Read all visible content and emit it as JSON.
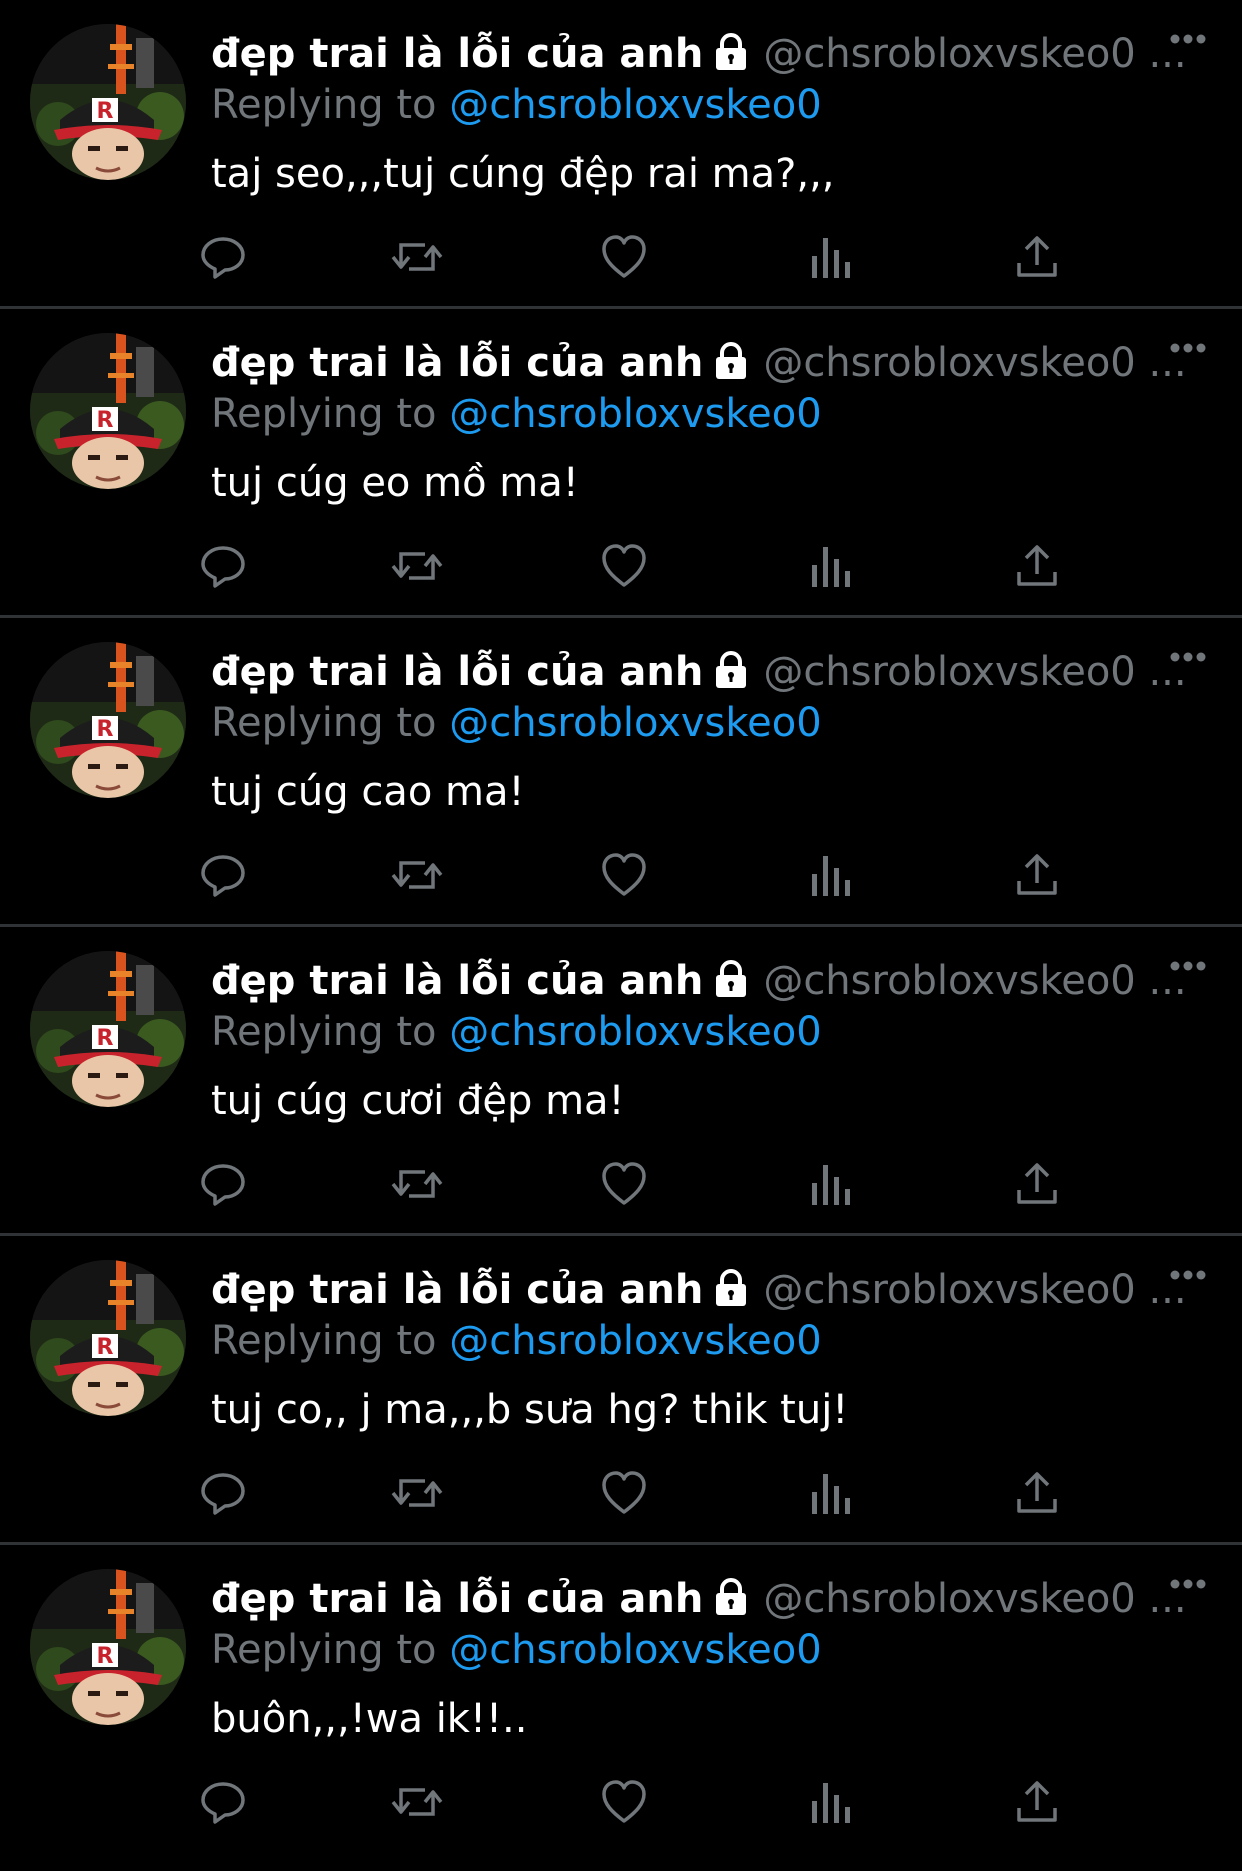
{
  "icons": {
    "lock": "lock-icon",
    "more": "more-icon",
    "reply": "reply-icon",
    "retweet": "retweet-icon",
    "like": "heart-icon",
    "views": "views-icon",
    "share": "share-icon"
  },
  "colors": {
    "background": "#000000",
    "name": "#ffffff",
    "muted": "#71767b",
    "link": "#1d9bf0",
    "divider": "#2f3336"
  },
  "tweets": [
    {
      "display_name": "đẹp trai là lỗi của anh",
      "handle": "@chsrobloxvskeo0 ...",
      "replying_label": "Replying to",
      "replying_handle": "@chsrobloxvskeo0",
      "text": "taj seo,,,tuj cúng đệp rai ma?,,,"
    },
    {
      "display_name": "đẹp trai là lỗi của anh",
      "handle": "@chsrobloxvskeo0 ...",
      "replying_label": "Replying to",
      "replying_handle": "@chsrobloxvskeo0",
      "text": "tuj cúg eo mồ ma!"
    },
    {
      "display_name": "đẹp trai là lỗi của anh",
      "handle": "@chsrobloxvskeo0 ...",
      "replying_label": "Replying to",
      "replying_handle": "@chsrobloxvskeo0",
      "text": "tuj cúg cao ma!"
    },
    {
      "display_name": "đẹp trai là lỗi của anh",
      "handle": "@chsrobloxvskeo0 ...",
      "replying_label": "Replying to",
      "replying_handle": "@chsrobloxvskeo0",
      "text": "tuj cúg cươi đệp ma!"
    },
    {
      "display_name": "đẹp trai là lỗi của anh",
      "handle": "@chsrobloxvskeo0 ...",
      "replying_label": "Replying to",
      "replying_handle": "@chsrobloxvskeo0",
      "text": "tuj co,, j ma,,,b sưa hg? thik tuj!"
    },
    {
      "display_name": "đẹp trai là lỗi của anh",
      "handle": "@chsrobloxvskeo0 ...",
      "replying_label": "Replying to",
      "replying_handle": "@chsrobloxvskeo0",
      "text": "buôn,,,!wa ik!!.."
    }
  ]
}
